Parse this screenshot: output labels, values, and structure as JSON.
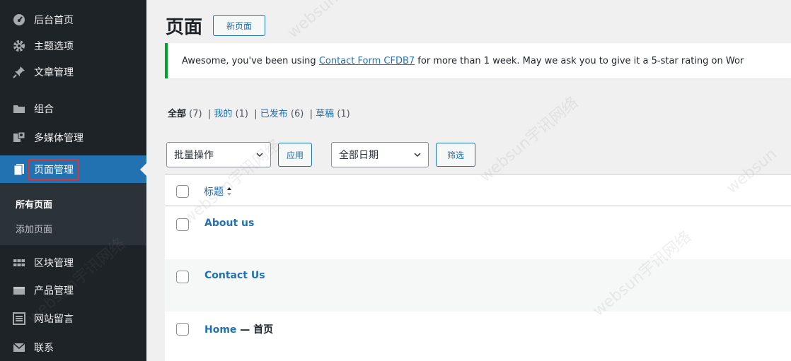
{
  "sidebar": {
    "items": [
      {
        "label": "后台首页",
        "icon": "dashboard-icon"
      },
      {
        "label": "主题选项",
        "icon": "gear-icon"
      },
      {
        "label": "文章管理",
        "icon": "pin-icon"
      },
      {
        "label": "组合",
        "icon": "folder-icon"
      },
      {
        "label": "多媒体管理",
        "icon": "media-icon"
      },
      {
        "label": "页面管理",
        "icon": "page-icon",
        "active": true
      },
      {
        "label": "区块管理",
        "icon": "blocks-icon"
      },
      {
        "label": "产品管理",
        "icon": "product-icon"
      },
      {
        "label": "网站留言",
        "icon": "list-icon"
      },
      {
        "label": "联系",
        "icon": "mail-icon"
      }
    ],
    "submenu": [
      {
        "label": "所有页面",
        "current": true
      },
      {
        "label": "添加页面"
      }
    ]
  },
  "header": {
    "title": "页面",
    "add_new_label": "新页面"
  },
  "notice": {
    "text_before": "Awesome, you've been using ",
    "link_text": "Contact Form CFDB7",
    "text_after": " for more than 1 week. May we ask you to give it a 5-star rating on Wor"
  },
  "filters": {
    "all_label": "全部",
    "all_count": "(7)",
    "mine_label": "我的",
    "mine_count": "(1)",
    "published_label": "已发布",
    "published_count": "(6)",
    "draft_label": "草稿",
    "draft_count": "(1)",
    "separator": "|"
  },
  "actions": {
    "bulk_select": "批量操作",
    "apply_label": "应用",
    "date_select": "全部日期",
    "filter_label": "筛选"
  },
  "table": {
    "column_title": "标题",
    "rows": [
      {
        "title": "About us",
        "suffix": ""
      },
      {
        "title": "Contact Us",
        "suffix": ""
      },
      {
        "title": "Home",
        "suffix": " — 首页"
      }
    ]
  },
  "watermark": {
    "text_a": "websun宇讯网络",
    "text_b": "websun"
  },
  "colors": {
    "sidebar_bg": "#1d2327",
    "accent": "#2271b1",
    "notice_border": "#00a32a",
    "highlight_border": "#d63638"
  }
}
